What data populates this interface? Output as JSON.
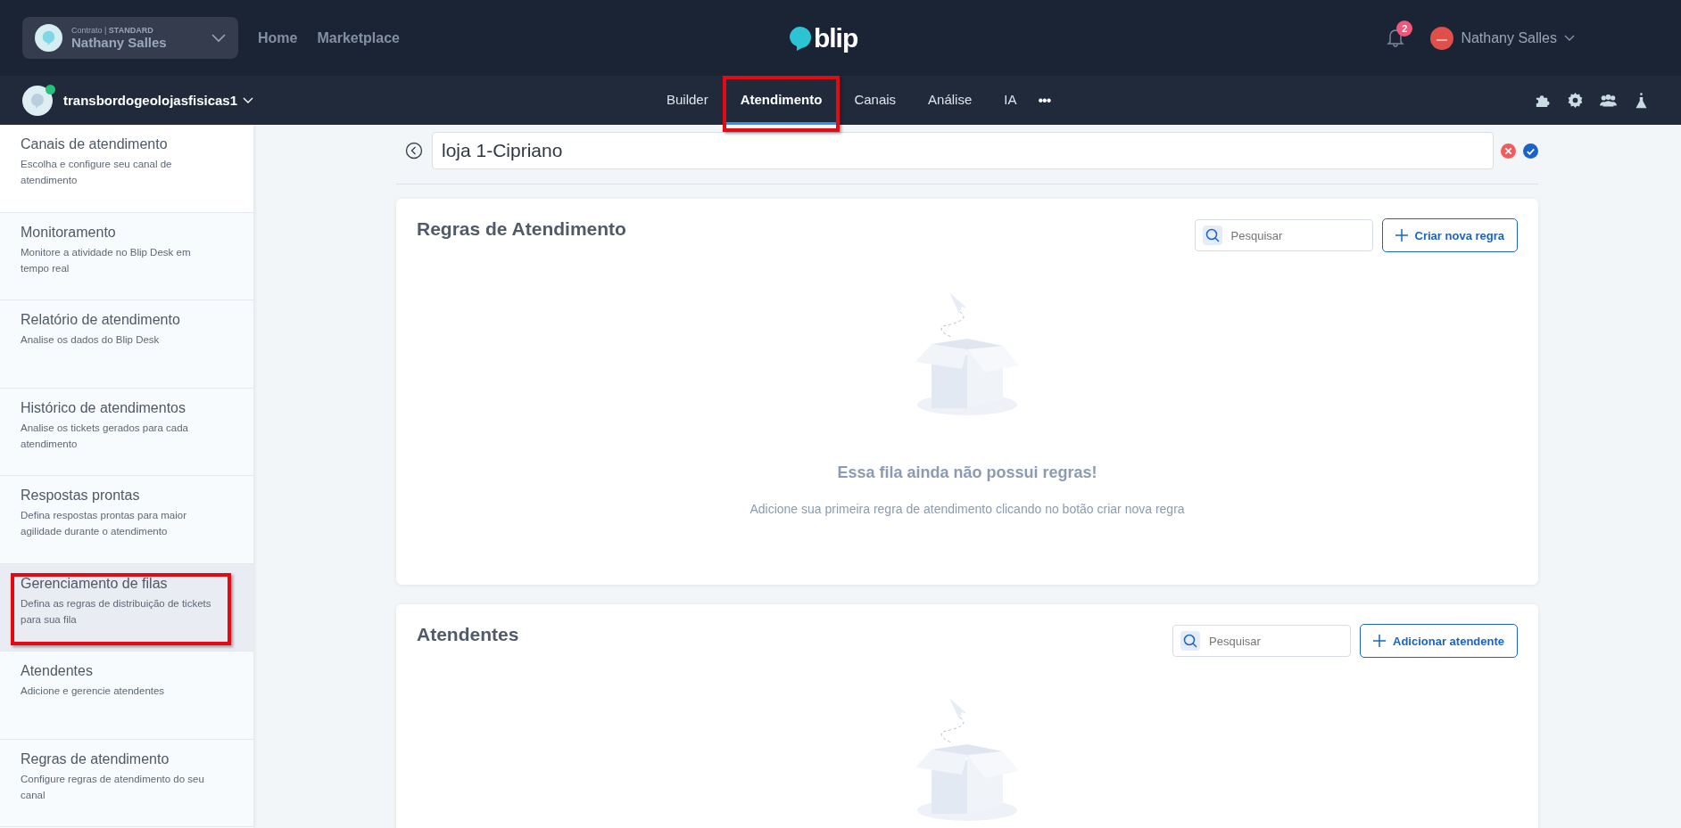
{
  "top_bar": {
    "contract": {
      "caption": "Contrato | **STANDARD**",
      "name": "Nathany Salles"
    },
    "links": [
      "Home",
      "Marketplace"
    ],
    "logo": "blip",
    "notifications": "2",
    "user": "Nathany Salles"
  },
  "bot_bar": {
    "bot": "transbordogeolojasfisicas1",
    "online": true,
    "more": "•••",
    "tabs": [
      {
        "label": "Builder",
        "selected": false,
        "highlighted": false
      },
      {
        "label": "Atendimento",
        "selected": true,
        "highlighted": true
      },
      {
        "label": "Canais",
        "selected": false,
        "highlighted": false
      },
      {
        "label": "Análise",
        "selected": false,
        "highlighted": false
      },
      {
        "label": "IA",
        "selected": false,
        "highlighted": false
      }
    ]
  },
  "sidebar": {
    "items": [
      {
        "title": "Canais de atendimento",
        "description": "Escolha e configure seu canal de atendimento",
        "selected": false,
        "highlighted": false
      },
      {
        "title": "Monitoramento",
        "description": "Monitore a atividade no Blip Desk em tempo real",
        "selected": false,
        "highlighted": false
      },
      {
        "title": "Relatório de atendimento",
        "description": "Analise os dados do Blip Desk",
        "selected": false,
        "highlighted": false
      },
      {
        "title": "Histórico de atendimentos",
        "description": "Analise os tickets gerados para cada atendimento",
        "selected": false,
        "highlighted": false
      },
      {
        "title": "Respostas prontas",
        "description": "Defina respostas prontas para maior agilidade durante o atendimento",
        "selected": false,
        "highlighted": false
      },
      {
        "title": "Gerenciamento de filas",
        "description": "Defina as regras de distribuição de tickets para sua fila",
        "selected": true,
        "highlighted": true
      },
      {
        "title": "Atendentes",
        "description": "Adicione e gerencie atendentes",
        "selected": false,
        "highlighted": false
      },
      {
        "title": "Regras de atendimento",
        "description": "Configure regras de atendimento do seu canal",
        "selected": false,
        "highlighted": false
      }
    ]
  },
  "queue": {
    "name": "loja 1-Cipriano"
  },
  "sections": [
    {
      "title": "Regras de Atendimento",
      "search_placeholder": "Pesquisar",
      "button": "Criar nova regra",
      "empty_title": "Essa fila ainda não possui regras!",
      "empty_text": "Adicione sua primeira regra de atendimento clicando no botão criar nova regra"
    },
    {
      "title": "Atendentes",
      "search_placeholder": "Pesquisar",
      "button": "Adicionar atendente"
    }
  ]
}
